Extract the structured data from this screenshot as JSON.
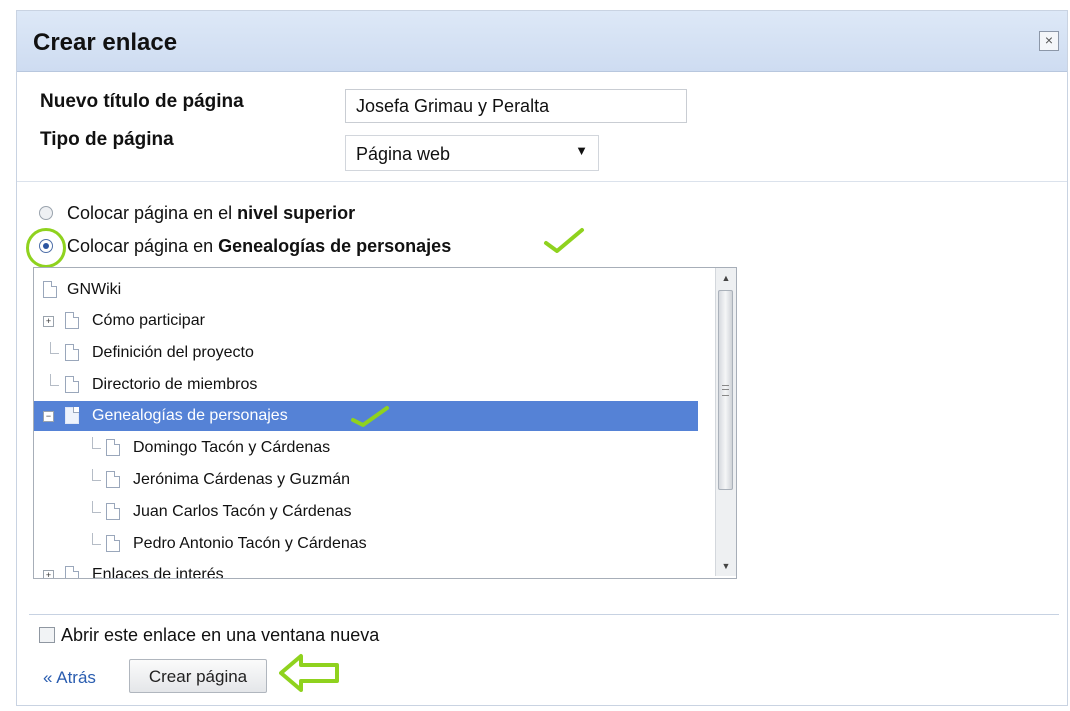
{
  "dialog": {
    "title": "Crear enlace",
    "close_icon": "close-icon",
    "close_symbol": "×"
  },
  "form": {
    "title_label": "Nuevo título de página",
    "title_value": "Josefa Grimau y Peralta",
    "type_label": "Tipo de página",
    "type_value": "Página web"
  },
  "placement": {
    "option_top_prefix": "Colocar página en el ",
    "option_top_bold": "nivel superior",
    "option_parent_prefix": "Colocar página en ",
    "option_parent_bold": "Genealogías de personajes",
    "selected": "parent"
  },
  "tree": {
    "items": [
      {
        "label": "GNWiki",
        "expander": "",
        "selected": false
      },
      {
        "label": "Cómo participar",
        "expander": "+",
        "selected": false
      },
      {
        "label": "Definición del proyecto",
        "expander": "",
        "selected": false
      },
      {
        "label": "Directorio de miembros",
        "expander": "",
        "selected": false
      },
      {
        "label": "Genealogías de personajes",
        "expander": "−",
        "selected": true
      },
      {
        "label": "Domingo Tacón y Cárdenas",
        "expander": "",
        "selected": false
      },
      {
        "label": "Jerónima Cárdenas y Guzmán",
        "expander": "",
        "selected": false
      },
      {
        "label": "Juan Carlos Tacón y Cárdenas",
        "expander": "",
        "selected": false
      },
      {
        "label": "Pedro Antonio Tacón y Cárdenas",
        "expander": "",
        "selected": false
      },
      {
        "label": "Enlaces de interés",
        "expander": "+",
        "selected": false
      }
    ]
  },
  "footer": {
    "new_window_label": "Abrir este enlace en una ventana nueva",
    "new_window_checked": false,
    "back_label": "« Atrás",
    "create_label": "Crear página"
  },
  "annotations": {
    "checkmark_color": "#8fd21e",
    "ring_color": "#8fd21e",
    "arrow_color": "#8fd21e",
    "arrow_icon": "left-arrow-icon"
  },
  "colors": {
    "header_bg": "#d5e1f4",
    "selection_bg": "#5582d6",
    "link": "#2a5db0"
  }
}
